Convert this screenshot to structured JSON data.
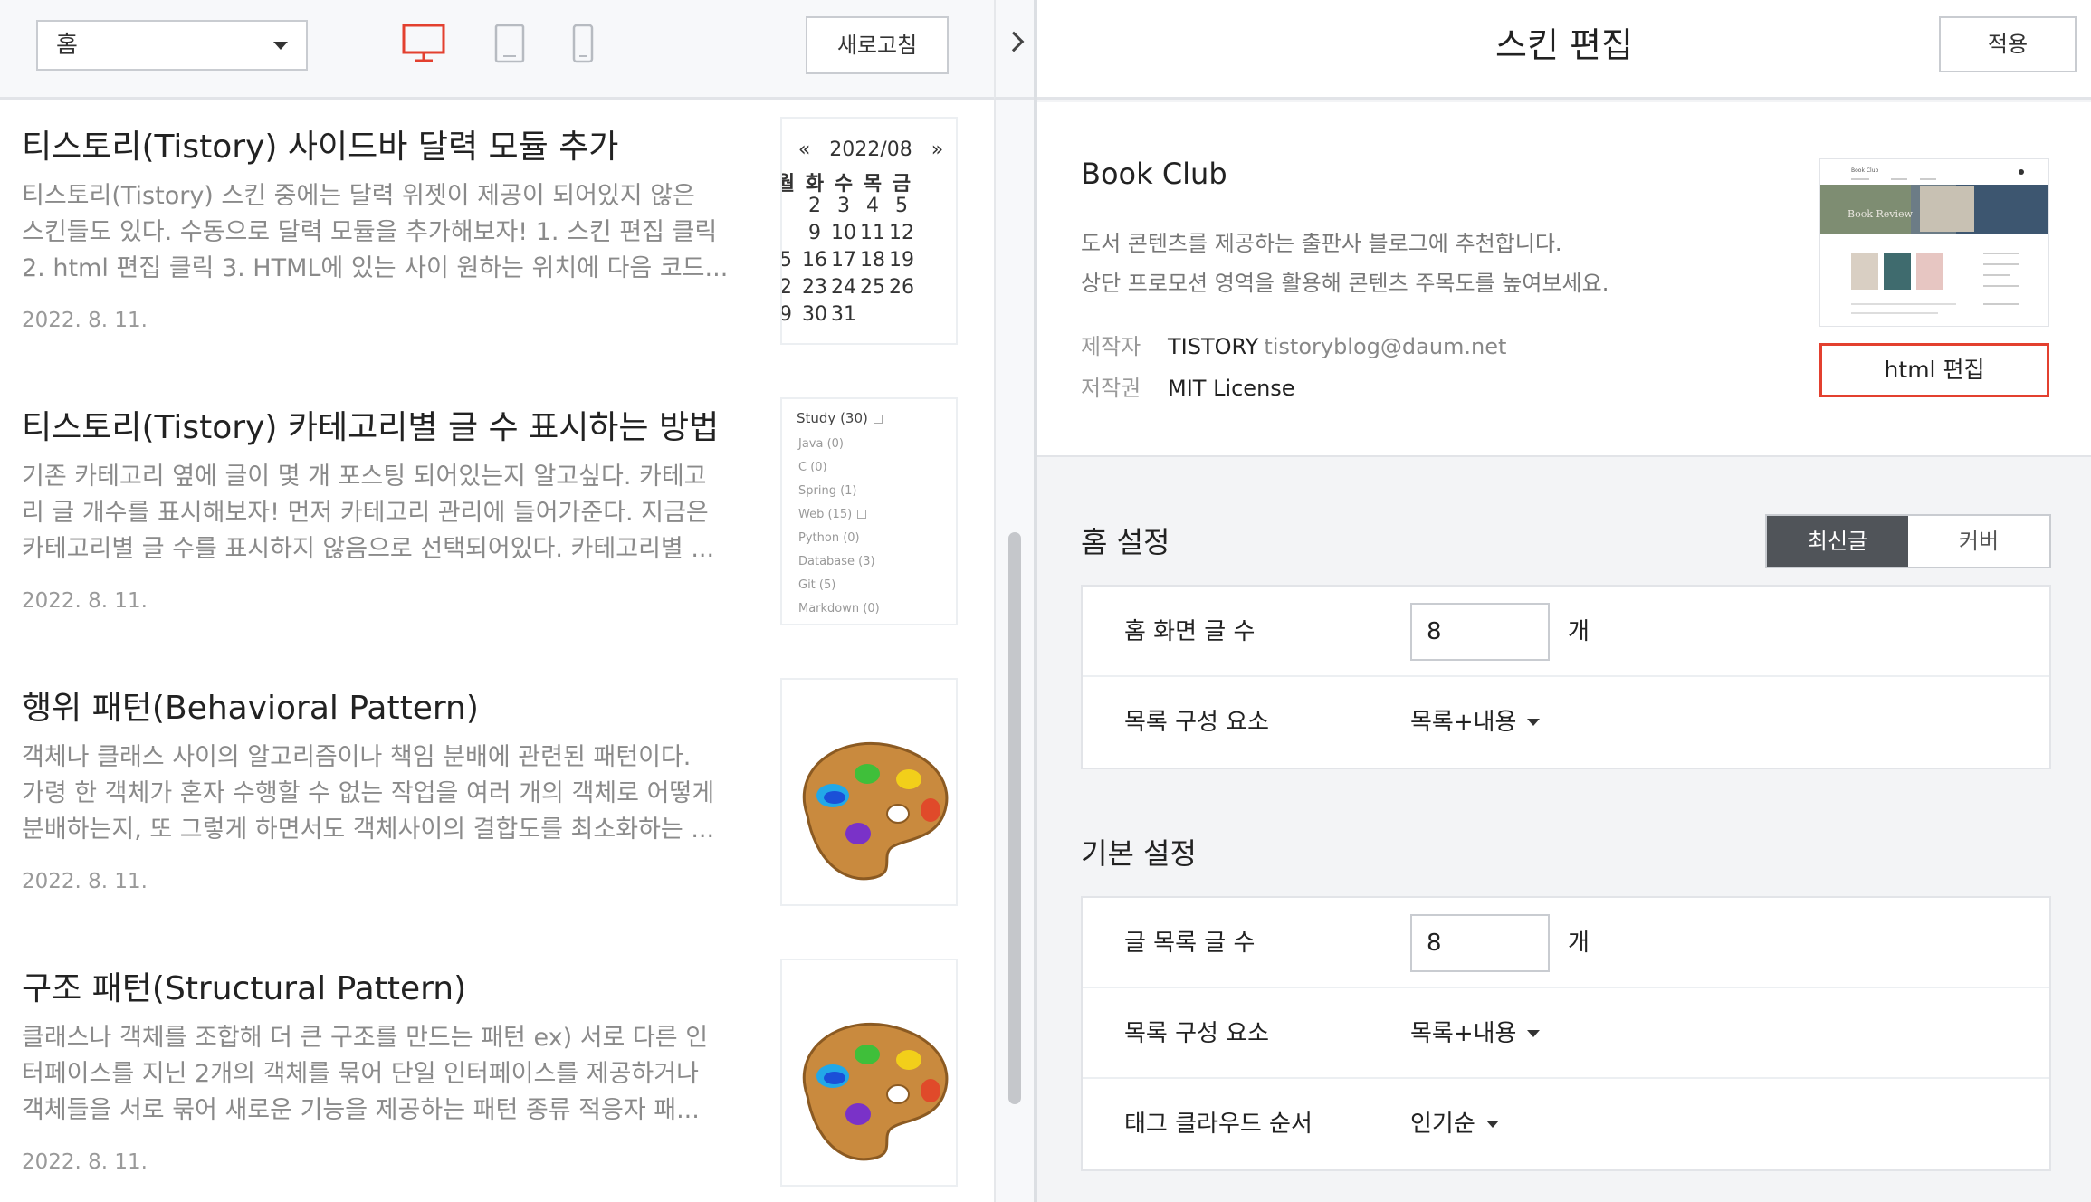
{
  "preview": {
    "page_select": "홈",
    "refresh_label": "새로고침",
    "posts": [
      {
        "title": "티스토리(Tistory) 사이드바 달력 모듈 추가",
        "excerpt": [
          "티스토리(Tistory) 스킨 중에는 달력 위젯이 제공이 되어있지 않은",
          "스킨들도 있다. 수동으로 달력 모듈을 추가해보자! 1. 스킨 편집 클릭",
          "2. html 편집 클릭 3. HTML에 있는 사이 원하는 위치에 다음 코드..."
        ],
        "date": "2022. 8. 11."
      },
      {
        "title": "티스토리(Tistory) 카테고리별 글 수 표시하는 방법",
        "excerpt": [
          "기존 카테고리 옆에 글이 몇 개 포스팅 되어있는지 알고싶다. 카테고",
          "리 글 개수를 표시해보자! 먼저 카테고리 관리에 들어가준다. 지금은",
          "카테고리별 글 수를 표시하지 않음으로 선택되어있다. 카테고리별 ..."
        ],
        "date": "2022. 8. 11."
      },
      {
        "title": "행위 패턴(Behavioral Pattern)",
        "excerpt": [
          "객체나 클래스 사이의 알고리즘이나 책임 분배에 관련된 패턴이다.",
          "가령 한 객체가 혼자 수행할 수 없는 작업을 여러 개의 객체로 어떻게",
          "분배하는지, 또 그렇게 하면서도 객체사이의 결합도를 최소화하는 ..."
        ],
        "date": "2022. 8. 11."
      },
      {
        "title": "구조 패턴(Structural Pattern)",
        "excerpt": [
          "클래스나 객체를 조합해 더 큰 구조를 만드는 패턴 ex) 서로 다른 인",
          "터페이스를 지닌 2개의 객체를 묶어 단일 인터페이스를 제공하거나",
          "객체들을 서로 묶어 새로운 기능을 제공하는 패턴 종류 적응자 패..."
        ],
        "date": "2022. 8. 11."
      }
    ],
    "calendar": {
      "prev": "«",
      "month": "2022/08",
      "next": "»",
      "dow": [
        "월",
        "화",
        "수",
        "목",
        "금"
      ],
      "weeks": [
        [
          "",
          "2",
          "3",
          "4",
          "5"
        ],
        [
          "",
          "9",
          "10",
          "11",
          "12"
        ],
        [
          "5",
          "16",
          "17",
          "18",
          "19"
        ],
        [
          "2",
          "23",
          "24",
          "25",
          "26"
        ],
        [
          "9",
          "30",
          "31",
          "",
          ""
        ]
      ]
    },
    "categories": [
      "Study (30)",
      "Java (0)",
      "C (0)",
      "Spring (1)",
      "Web (15)",
      "Python (0)",
      "Database (3)",
      "Git (5)",
      "Markdown (0)"
    ],
    "active_device": "desktop-icon",
    "accent_color": "#e3402f"
  },
  "editor": {
    "title": "스킨 편집",
    "apply_label": "적용",
    "skin": {
      "name": "Book Club",
      "desc": [
        "도서 콘텐츠를 제공하는 출판사 블로그에 추천합니다.",
        "상단 프로모션 영역을 활용해 콘텐츠 주목도를 높여보세요."
      ],
      "author_label": "제작자",
      "author": "TISTORY",
      "author_email": "tistoryblog@daum.net",
      "license_label": "저작권",
      "license": "MIT License",
      "html_edit_label": "html 편집",
      "thumb_title": "Book Club",
      "thumb_banner": "Book Review"
    },
    "home_settings": {
      "title": "홈 설정",
      "seg_active": "최신글",
      "seg_inactive": "커버",
      "post_count_label": "홈 화면 글 수",
      "post_count": "8",
      "unit": "개",
      "list_label": "목록 구성 요소",
      "list_value": "목록+내용"
    },
    "basic_settings": {
      "title": "기본 설정",
      "post_count_label": "글 목록 글 수",
      "post_count": "8",
      "unit": "개",
      "list_label": "목록 구성 요소",
      "list_value": "목록+내용",
      "tag_label": "태그 클라우드 순서",
      "tag_value": "인기순"
    }
  }
}
